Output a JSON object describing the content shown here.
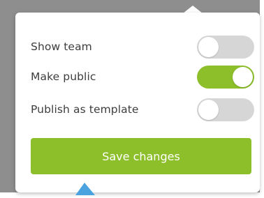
{
  "settings": {
    "items": [
      {
        "label": "Show team",
        "toggle_state": "off"
      },
      {
        "label": "Make public",
        "toggle_state": "on"
      },
      {
        "label": "Publish as template",
        "toggle_state": "off"
      }
    ],
    "save_label": "Save changes"
  },
  "colors": {
    "accent": "#8cbf2a",
    "toggle_off": "#d6d6d6",
    "backdrop": "#8e8e8e",
    "pointer": "#4aa3df"
  },
  "icons": {
    "pointer": "pointer-arrow-icon"
  }
}
